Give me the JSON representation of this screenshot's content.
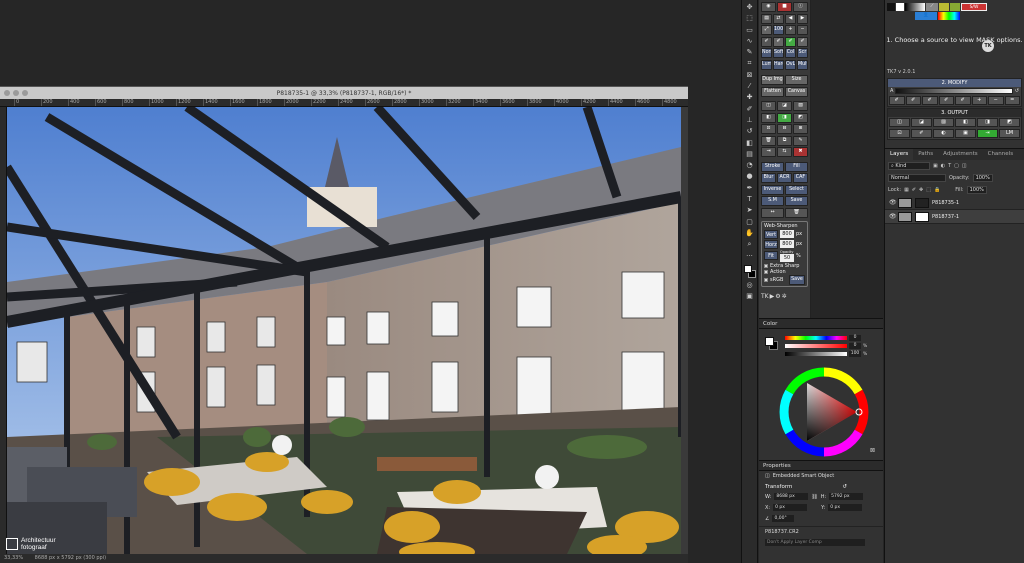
{
  "document": {
    "title": "P818735-1 @ 33,3% (P818737-1, RGB/16*) *",
    "ruler_ticks": [
      "0",
      "200",
      "400",
      "600",
      "800",
      "1000",
      "1200",
      "1400",
      "1600",
      "1800",
      "2000",
      "2200",
      "2400",
      "2600",
      "2800",
      "3000",
      "3200",
      "3400",
      "3600",
      "3800",
      "4000",
      "4200",
      "4400",
      "4600",
      "4800",
      "5000",
      "5200"
    ],
    "status_zoom": "33,33%",
    "status_size": "8688 px x 5792 px (300 ppi)"
  },
  "watermark": {
    "line1": "Architectuur",
    "line2": "fotograaf"
  },
  "tk_panel": {
    "zoom_label": "100%",
    "row_norm": [
      "Norm",
      "Soft",
      "Col",
      "Scr"
    ],
    "row_lum": [
      "Lum",
      "Hard",
      "OvL",
      "Mult"
    ],
    "dup_img": "Dup Img",
    "size": "Size",
    "flatten": "Flatten",
    "canvas": "Canvas",
    "stroke": "Stroke",
    "fill": "Fill",
    "blur": "Blur",
    "acr": "ACR",
    "caf": "CAF",
    "inverse": "Inverse",
    "select": "Select",
    "sm": "S.M",
    "save": "Save",
    "web_sharpen_title": "Web-Sharpen",
    "vert": "Vert",
    "vert_val": "800",
    "horz": "Horz",
    "horz_val": "800",
    "fit": "Fit",
    "opacity_label": "Opacity",
    "opacity_val": "50",
    "pct": "%",
    "px": "px",
    "extra_sharp": "Extra Sharp",
    "action": "Action",
    "srgb": "sRGB",
    "save2": "Save",
    "footer": "TK"
  },
  "color_panel": {
    "title": "Color",
    "values": [
      "0",
      "0",
      "100"
    ],
    "units": [
      "",
      "%",
      "%"
    ],
    "colors": {
      "hue": "#ff0000"
    }
  },
  "properties": {
    "title": "Properties",
    "kind": "Embedded Smart Object",
    "transform": "Transform",
    "w_label": "W:",
    "w_val": "8688 px",
    "h_label": "H:",
    "h_val": "5792 px",
    "x_label": "X:",
    "x_val": "0 px",
    "y_label": "Y:",
    "y_val": "0 px",
    "angle": "0,00°",
    "filename": "P818737.CR2",
    "apply_hint": "Don't Apply Layer Comp"
  },
  "right_col": {
    "sw_label": "S/W",
    "mask_hint": "1. Choose a source to view MASK options.",
    "tk_version": "TK7 v 2.0.1",
    "tk_logo": "TK",
    "modify_title": "2. MODIFY",
    "output_title": "3. OUTPUT",
    "lm": "LM"
  },
  "layers": {
    "tabs": [
      "Layers",
      "Paths",
      "Adjustments",
      "Channels"
    ],
    "kind": "Kind",
    "blend": "Normal",
    "opacity_label": "Opacity:",
    "opacity_val": "100%",
    "lock_label": "Lock:",
    "fill_label": "Fill:",
    "fill_val": "100%",
    "items": [
      {
        "name": "P818735-1"
      },
      {
        "name": "P818737-1"
      }
    ]
  }
}
